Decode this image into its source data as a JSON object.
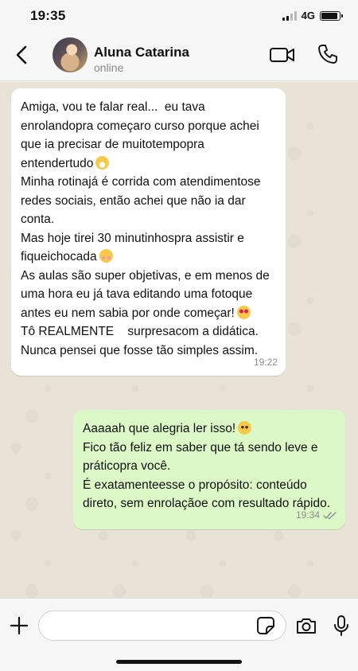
{
  "status_bar": {
    "time": "19:35",
    "network": "4G",
    "signal_bars": 4,
    "signal_active": 2,
    "battery_level": 0.9
  },
  "header": {
    "contact_name": "Aluna Catarina",
    "contact_status": "online",
    "icons": {
      "back": "chevron-left-icon",
      "video": "video-camera-icon",
      "call": "phone-icon"
    }
  },
  "messages": [
    {
      "direction": "incoming",
      "lines": [
        "Amiga, vou te falar real...  eu tava enrolandopra começaro curso porque achei que ia precisar de muitotempopra entendertudo",
        "Minha rotinajá é corrida com atendimentose redes sociais, então achei que não ia dar conta.",
        "Mas hoje tirei 30 minutinhospra assistir e fiqueichocada",
        "As aulas são super objetivas, e em menos de uma hora eu já tava editando uma fotoque antes eu nem sabia por onde começar!",
        "Tô REALMENTE    surpresacom a didática. Nunca pensei que fosse tão simples assim."
      ],
      "emojis": [
        "grimacing-face-emoji",
        "flushed-face-emoji",
        "heart-eyes-emoji"
      ],
      "time": "19:22"
    },
    {
      "direction": "outgoing",
      "lines": [
        "Aaaaah que alegria ler isso!",
        "Fico tão feliz em saber que tá sendo leve e práticopra você.",
        "É exatamenteesse o propósito: conteúdo direto, sem enrolaçãoe com resultado rápido."
      ],
      "emojis": [
        "pleading-face-emoji"
      ],
      "time": "19:34",
      "status": "read"
    }
  ],
  "input": {
    "placeholder": "",
    "value": ""
  },
  "icons": {
    "plus": "plus-icon",
    "sticker": "sticker-icon",
    "camera": "camera-icon",
    "mic": "microphone-icon"
  },
  "colors": {
    "outgoing_bubble": "#dcf8c6",
    "incoming_bubble": "#ffffff",
    "chat_background": "#e9e3d7",
    "read_ticks": "#8c8c8c"
  }
}
